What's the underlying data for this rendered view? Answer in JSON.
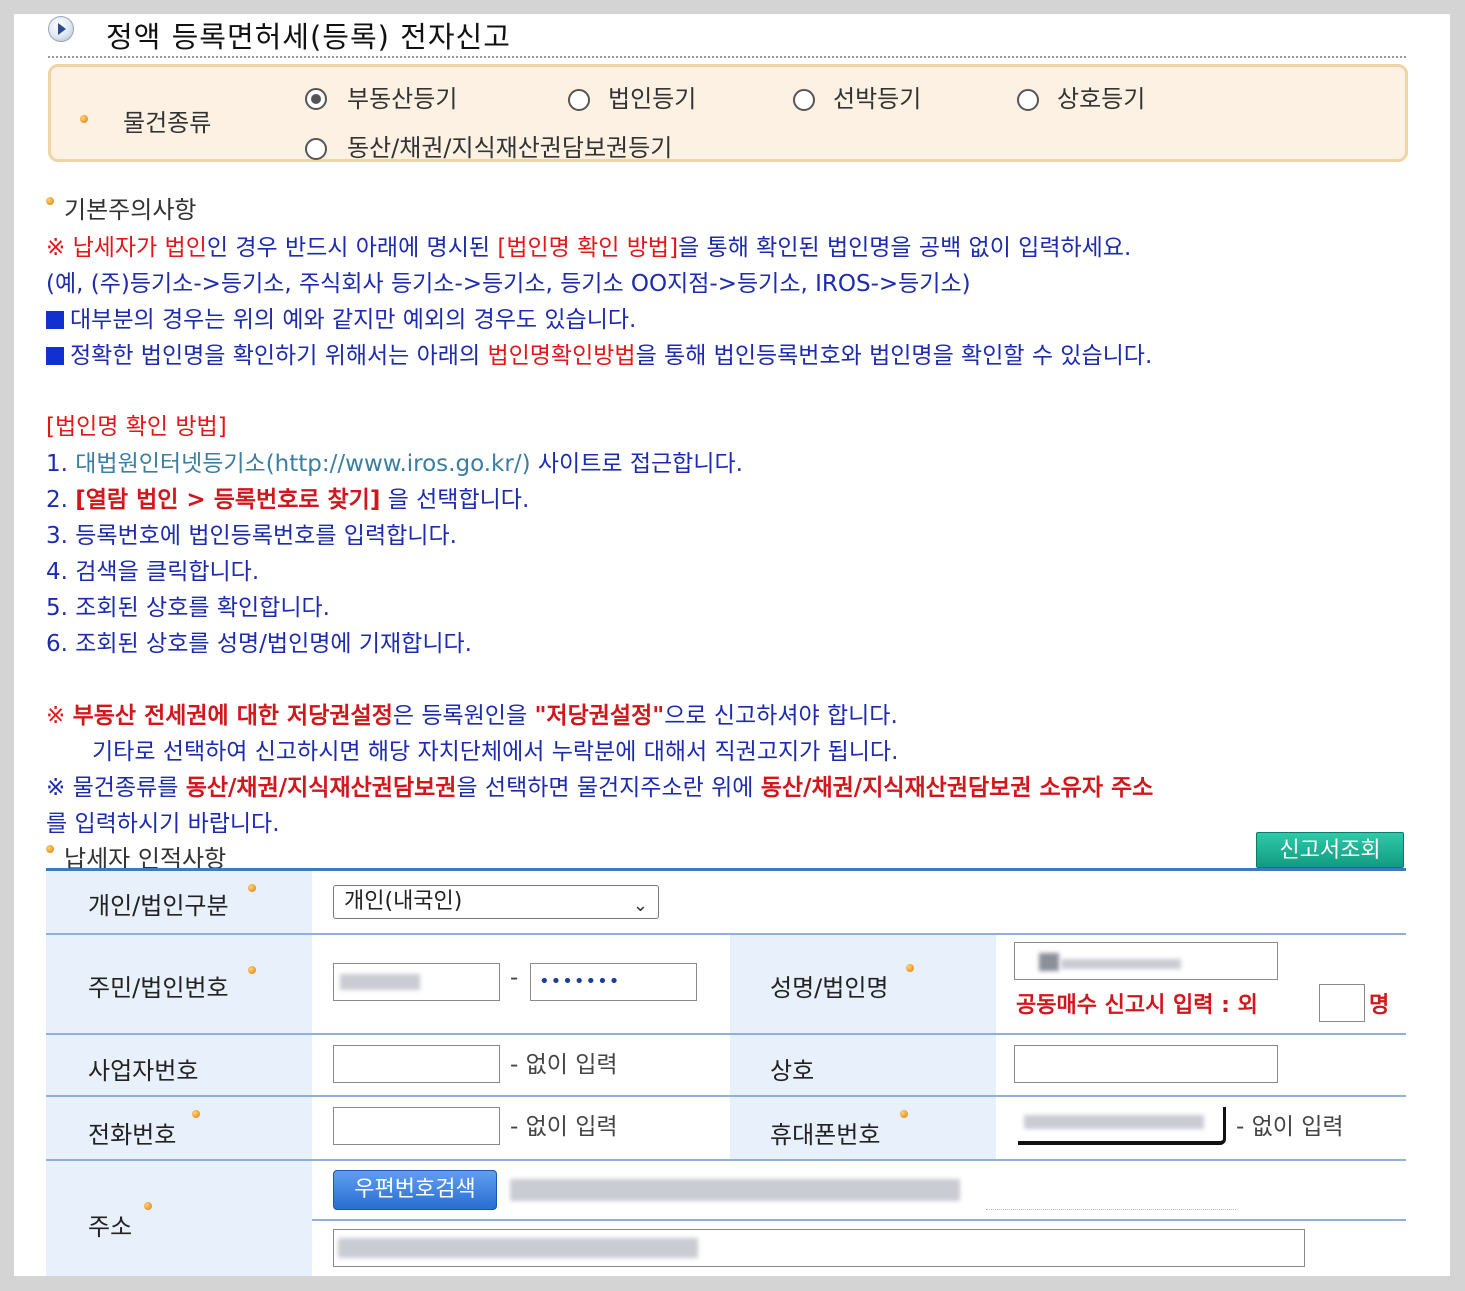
{
  "page": {
    "title": "정액 등록면허세(등록) 전자신고"
  },
  "kind": {
    "label": "물건종류",
    "options": [
      {
        "label": "부동산등기",
        "checked": true
      },
      {
        "label": "법인등기",
        "checked": false
      },
      {
        "label": "선박등기",
        "checked": false
      },
      {
        "label": "상호등기",
        "checked": false
      },
      {
        "label": "동산/채권/지식재산권담보권등기",
        "checked": false
      }
    ]
  },
  "notice": {
    "heading": "기본주의사항",
    "l1": {
      "a": "※ ",
      "b": "납세자가 법인",
      "c": "인 경우 반드시 아래에 명시된 ",
      "d": "[법인명 확인 방법]",
      "e": "을 통해 확인된 법인명을 공백 없이 입력하세요."
    },
    "l2": "(예, (주)등기소->등기소, 주식회사 등기소->등기소, 등기소 OO지점->등기소, IROS->등기소)",
    "l3": "대부분의 경우는 위의 예와 같지만 예외의 경우도 있습니다.",
    "l4": {
      "a": "정확한 법인명을 확인하기 위해서는 아래의 ",
      "b": "법인명확인방법",
      "c": "을 통해 법인등록번호와 법인명을 확인할 수 있습니다."
    },
    "method_title": "[법인명 확인 방법]",
    "steps": {
      "s1a": "1. ",
      "s1b": "대법원인터넷등기소(http://www.iros.go.kr/)",
      "s1c": " 사이트로 접근합니다.",
      "s2a": "2. ",
      "s2b": "[열람 법인 > 등록번호로 찾기]",
      "s2c": " 을 선택합니다.",
      "s3": "3. 등록번호에 법인등록번호를 입력합니다.",
      "s4": "4. 검색을 클릭합니다.",
      "s5": "5. 조회된 상호를 확인합니다.",
      "s6": "6. 조회된 상호를 성명/법인명에 기재합니다."
    },
    "n1": {
      "a": "※ ",
      "b": "부동산 전세권에 대한 저당권설정",
      "c": "은 등록원인을 ",
      "d": "\"저당권설정\"",
      "e": "으로 신고하셔야 합니다."
    },
    "n2": "기타로 선택하여 신고하시면 해당 자치단체에서 누락분에 대해서 직권고지가 됩니다.",
    "n3": {
      "a": "※ 물건종류를 ",
      "b": "동산/채권/지식재산권담보권",
      "c": "을 선택하면 물건지주소란 위에 ",
      "d": "동산/채권/지식재산권담보권 소유자 주소"
    },
    "n4": "를 입력하시기 바랍니다."
  },
  "taxpayer": {
    "heading": "납세자 인적사항",
    "lookup_button": "신고서조회",
    "type_label": "개인/법인구분",
    "type_value": "개인(내국인)",
    "id_label": "주민/법인번호",
    "id_dash": "-",
    "id_back_mask": "•••••••",
    "name_label": "성명/법인명",
    "joint_text": "공동매수 신고시 입력 : 외",
    "joint_unit": "명",
    "biz_label": "사업자번호",
    "biz_hint": "- 없이 입력",
    "shop_label": "상호",
    "phone_label": "전화번호",
    "phone_hint": "- 없이 입력",
    "mobile_label": "휴대폰번호",
    "mobile_hint": "- 없이 입력",
    "addr_label": "주소",
    "zip_button": "우편번호검색"
  },
  "colors": {
    "accent_blue": "#1d2bb0",
    "accent_red": "#e3161a",
    "label_bg": "#e8f0fb"
  }
}
